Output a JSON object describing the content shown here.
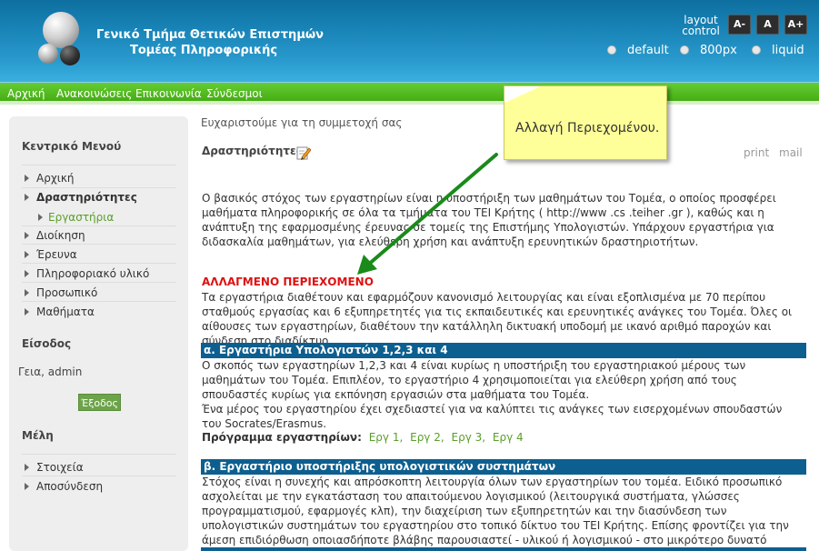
{
  "header": {
    "title_line1": "Γενικό Τμήμα Θετικών Επιστημών",
    "title_line2": "Τομέας Πληροφορικής",
    "layout_control_label": "layout control",
    "font_buttons": [
      "A-",
      "A",
      "A+"
    ],
    "layout_options": [
      "default",
      "800px",
      "liquid"
    ]
  },
  "nav": {
    "items": [
      "Αρχική",
      "Ανακοινώσεις",
      "Επικοινωνία",
      "Σύνδεσμοι"
    ]
  },
  "sidebar": {
    "main_menu_title": "Κεντρικό Μενού",
    "items": [
      "Αρχική",
      "Δραστηριότητες",
      "Διοίκηση",
      "Έρευνα",
      "Πληροφοριακό υλικό",
      "Προσωπικό",
      "Μαθήματα"
    ],
    "sub_item": "Εργαστήρια",
    "login_title": "Είσοδος",
    "greeting": "Γεια, admin",
    "logout_button": "Έξοδος",
    "members_title": "Μέλη",
    "member_items": [
      "Στοιχεία",
      "Αποσύνδεση"
    ]
  },
  "content": {
    "thanks": "Ευχαριστούμε για τη συμμετοχή σας",
    "section_title": "Δραστηριότητες",
    "print": "print",
    "mail": "mail",
    "intro": "Ο βασικός στόχος των εργαστηρίων είναι η υποστήριξη των μαθημάτων του Τομέα, ο οποίος προσφέρει μαθήματα πληροφορικής σε όλα τα τμήματα του ΤΕΙ Κρήτης ( http://www .cs .teiher .gr ), καθώς και η ανάπτυξη της εφαρμοσμένης έρευνας σε τομείς της Επιστήμης Υπολογιστών. Υπάρχουν εργαστήρια για διδασκαλία μαθημάτων, για ελεύθερη χρήση και ανάπτυξη ερευνητικών δραστηριοτήτων.",
    "changed_label": "ΑΛΛΑΓΜΕΝΟ ΠΕΡΙΕΧΟΜΕΝΟ",
    "changed_text": "Τα εργαστήρια διαθέτουν και εφαρμόζουν κανονισμό λειτουργίας και είναι εξοπλισμένα με 70 περίπου σταθμούς εργασίας και 6 εξυπηρετητές για τις εκπαιδευτικές και ερευνητικές ανάγκες του Τομέα. Όλες οι αίθουσες των εργαστηρίων, διαθέτουν την κατάλληλη δικτυακή υποδομή με ικανό αριθμό παροχών και σύνδεση στο διαδίκτυο.",
    "heading_a": "α. Εργαστήρια Υπολογιστών 1,2,3 και 4",
    "text_a_1": "Ο σκοπός των εργαστηρίων 1,2,3 και 4 είναι κυρίως η υποστήριξη του εργαστηριακού μέρους των μαθημάτων του Τομέα. Επιπλέον, το εργαστήριο 4 χρησιμοποιείται για ελεύθερη χρήση από τους σπουδαστές κυρίως για εκπόνηση εργασιών στα μαθήματα του Τομέα.",
    "text_a_2": "Ένα μέρος του εργαστηρίου έχει σχεδιαστεί για να καλύπτει τις ανάγκες των εισερχομένων σπουδαστών του Socrates/Erasmus.",
    "schedule_label": "Πρόγραμμα εργαστηρίων:",
    "schedule_links": [
      "Εργ 1,",
      "Εργ 2,",
      "Εργ 3,",
      "Εργ 4"
    ],
    "heading_b": "β. Εργαστήριο υποστήριξης υπολογιστικών συστημάτων",
    "text_b": "Στόχος είναι η συνεχής και απρόσκοπτη λειτουργία όλων των εργαστηρίων του τομέα. Ειδικό προσωπικό ασχολείται με την εγκατάσταση του απαιτούμενου λογισμικού (λειτουργικά συστήματα, γλώσσες προγραμματισμού, εφαρμογές κλπ), την διαχείριση των εξυπηρετητών και την διασύνδεση των υπολογιστικών συστημάτων του εργαστηρίου στο τοπικό δίκτυο του ΤΕΙ Κρήτης. Επίσης φροντίζει για την άμεση επιδιόρθωση οποιασδήποτε βλάβης παρουσιαστεί - υλικού ή λογισμικού - στο μικρότερο δυνατό χρόνο."
  },
  "annotation": {
    "note_text": "Αλλαγή Περιεχομένου.",
    "arrow_color": "#1a8a1a",
    "note_color": "#ffff99"
  },
  "colors": {
    "header_blue": "#1a86b9",
    "nav_green": "#46ad14",
    "section_bar": "#0d5f8f",
    "changed_red": "#dd1111",
    "link_green": "#5a9e2a"
  }
}
